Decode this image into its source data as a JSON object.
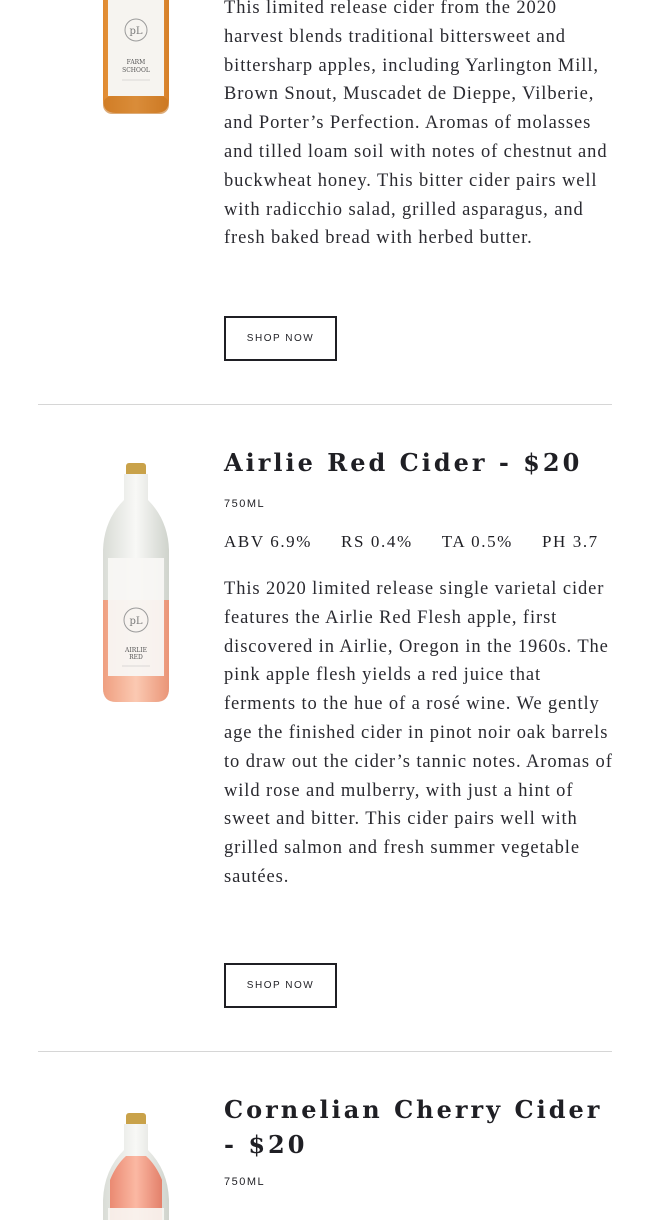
{
  "products": [
    {
      "bottle": {
        "label_line1": "FARM",
        "label_line2": "SCHOOL",
        "liquid_color": "#f0a04a",
        "logo": "pL"
      },
      "description": "This limited release cider from the 2020 harvest blends traditional bittersweet and bittersharp apples, including Yarlington Mill, Brown Snout, Muscadet de Dieppe, Vilberie, and Porter’s Perfection. Aromas of molasses and tilled loam soil with notes of chestnut and buckwheat honey. This bitter cider pairs well with radicchio salad, grilled asparagus, and fresh baked bread with herbed butter.",
      "shop_label": "SHOP NOW"
    },
    {
      "bottle": {
        "label_line1": "AIRLIE",
        "label_line2": "RED",
        "liquid_color": "#f5b89a",
        "logo": "pL"
      },
      "title": "Airlie Red Cider - $20",
      "size": "750ML",
      "stats": {
        "abv": "ABV 6.9%",
        "rs": "RS 0.4%",
        "ta": "TA 0.5%",
        "ph": "PH 3.7"
      },
      "description": "This 2020 limited release single varietal cider features the Airlie Red Flesh apple, first discovered in Airlie, Oregon in the 1960s. The pink apple flesh yields a red juice that ferments to the hue of a rosé wine. We gently age the finished cider in pinot noir oak barrels to draw out the cider’s tannic notes. Aromas of wild rose and mulberry, with just a hint of sweet and bitter. This cider pairs well with grilled salmon and fresh summer vegetable sautées.",
      "shop_label": "SHOP NOW"
    },
    {
      "bottle": {
        "liquid_color": "#f3a08a"
      },
      "title": "Cornelian Cherry Cider - $20",
      "size": "750ML"
    }
  ]
}
